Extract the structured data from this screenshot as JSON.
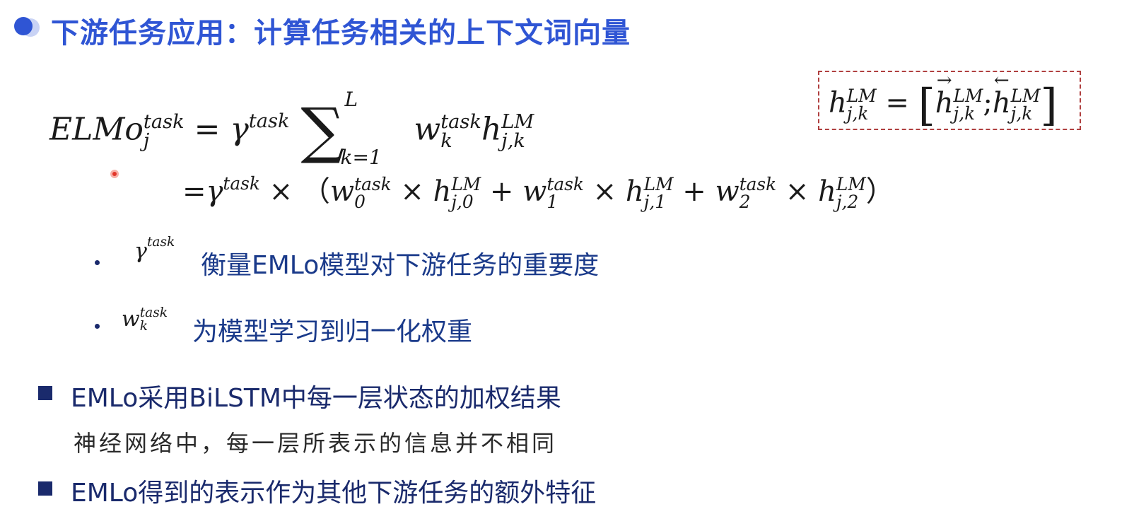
{
  "title": "下游任务应用：计算任务相关的上下文词向量",
  "formula": {
    "elmo": "ELMo",
    "task": "task",
    "j": "j",
    "eq": "=",
    "gamma": "γ",
    "L": "L",
    "k1": "k=1",
    "w": "w",
    "k": "k",
    "h": "h",
    "LM": "LM",
    "jk": "j,k",
    "eq2_prefix": "=γ",
    "times": "×",
    "lparen": "（",
    "rparen": "）",
    "plus": "+",
    "idx0": "0",
    "idx1": "1",
    "idx2": "2",
    "j0": "j,0",
    "j1": "j,1",
    "j2": "j,2",
    "lbracket": "[",
    "rbracket": "]",
    "semicolon": ";",
    "arrow_right": "→",
    "arrow_left": "←"
  },
  "bullets": [
    {
      "text": "衡量EMLo模型对下游任务的重要度"
    },
    {
      "text": "为模型学习到归一化权重"
    }
  ],
  "points": [
    {
      "text": "EMLo采用BiLSTM中每一层状态的加权结果",
      "sub": "神经网络中，每一层所表示的信息并不相同"
    },
    {
      "text": "EMLo得到的表示作为其他下游任务的额外特征"
    }
  ],
  "colors": {
    "title": "#2f55d4",
    "text": "#1a2a6c",
    "box_border": "#b04040"
  }
}
